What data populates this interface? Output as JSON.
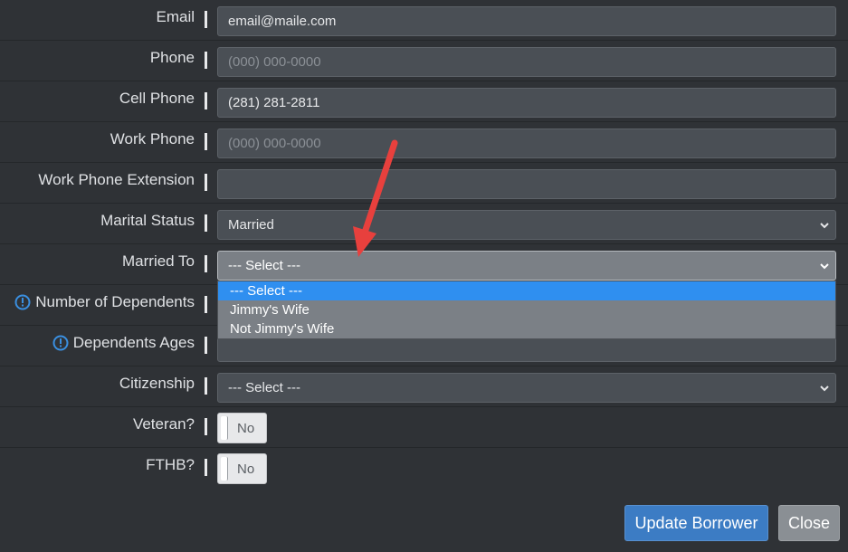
{
  "fields": {
    "email": {
      "label": "Email",
      "value": "email@maile.com"
    },
    "phone": {
      "label": "Phone",
      "placeholder": "(000) 000-0000"
    },
    "cell_phone": {
      "label": "Cell Phone",
      "value": "(281) 281-2811"
    },
    "work_phone": {
      "label": "Work Phone",
      "placeholder": "(000) 000-0000"
    },
    "work_phone_ext": {
      "label": "Work Phone Extension",
      "value": ""
    },
    "marital_status": {
      "label": "Marital Status",
      "value": "Married"
    },
    "married_to": {
      "label": "Married To",
      "value": "--- Select ---",
      "options": [
        "--- Select ---",
        "Jimmy's Wife",
        "Not Jimmy's Wife"
      ]
    },
    "num_dependents": {
      "label": "Number of Dependents"
    },
    "dependents_ages": {
      "label": "Dependents Ages"
    },
    "citizenship": {
      "label": "Citizenship",
      "value": "--- Select ---"
    },
    "veteran": {
      "label": "Veteran?",
      "toggle": "No"
    },
    "fthb": {
      "label": "FTHB?",
      "toggle": "No"
    }
  },
  "buttons": {
    "update": "Update Borrower",
    "close": "Close"
  },
  "icons": {
    "info": "info-circle-icon",
    "chevron": "chevron-down-icon",
    "annotation": "red-arrow-annotation"
  },
  "colors": {
    "background": "#2f3236",
    "input_bg": "#4a4f55",
    "highlight": "#2f8ff0",
    "primary_button": "#3c7cc4",
    "annotation_arrow": "#e8403d",
    "info_icon": "#3a8fe0"
  }
}
